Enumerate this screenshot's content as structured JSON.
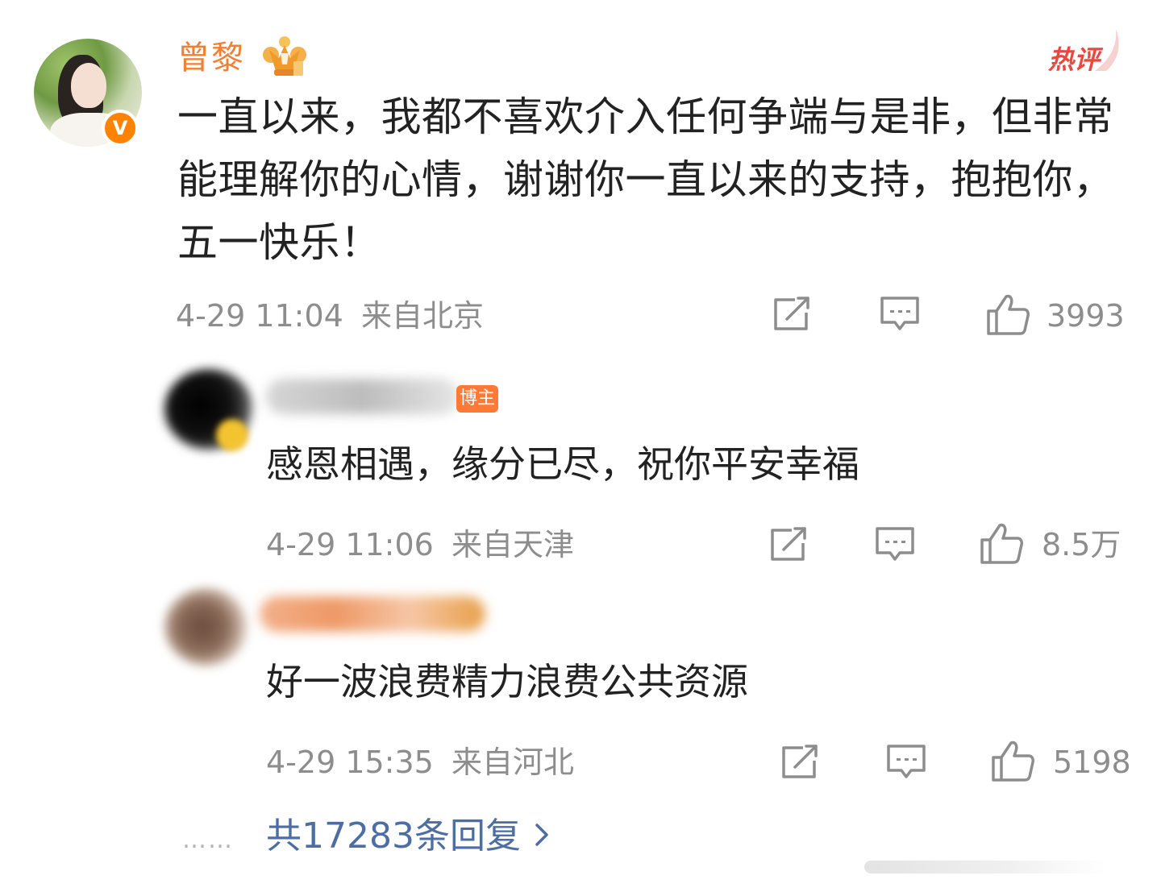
{
  "main_comment": {
    "username": "曾黎",
    "hot_label": "热评",
    "verified_mark": "V",
    "text": "一直以来，我都不喜欢介入任何争端与是非，但非常能理解你的心情，谢谢你一直以来的支持，抱抱你，五一快乐！",
    "time": "4-29 11:04",
    "location": "来自北京",
    "likes": "3993",
    "icons": [
      "share-icon",
      "comment-icon",
      "like-icon",
      "crown-badge-icon"
    ]
  },
  "replies": [
    {
      "badge": "博主",
      "text": "感恩相遇，缘分已尽，祝你平安幸福",
      "time": "4-29 11:06",
      "location": "来自天津",
      "likes": "8.5万"
    },
    {
      "text": "好一波浪费精力浪费公共资源",
      "time": "4-29 15:35",
      "location": "来自河北",
      "likes": "5198"
    }
  ],
  "footer": {
    "dots": "……",
    "total_replies": "共17283条回复"
  },
  "colors": {
    "username": "#f07f33",
    "hot": "#e8483f",
    "meta": "#8d8d8d",
    "link": "#4e6ea3",
    "verified": "#ff8200"
  }
}
